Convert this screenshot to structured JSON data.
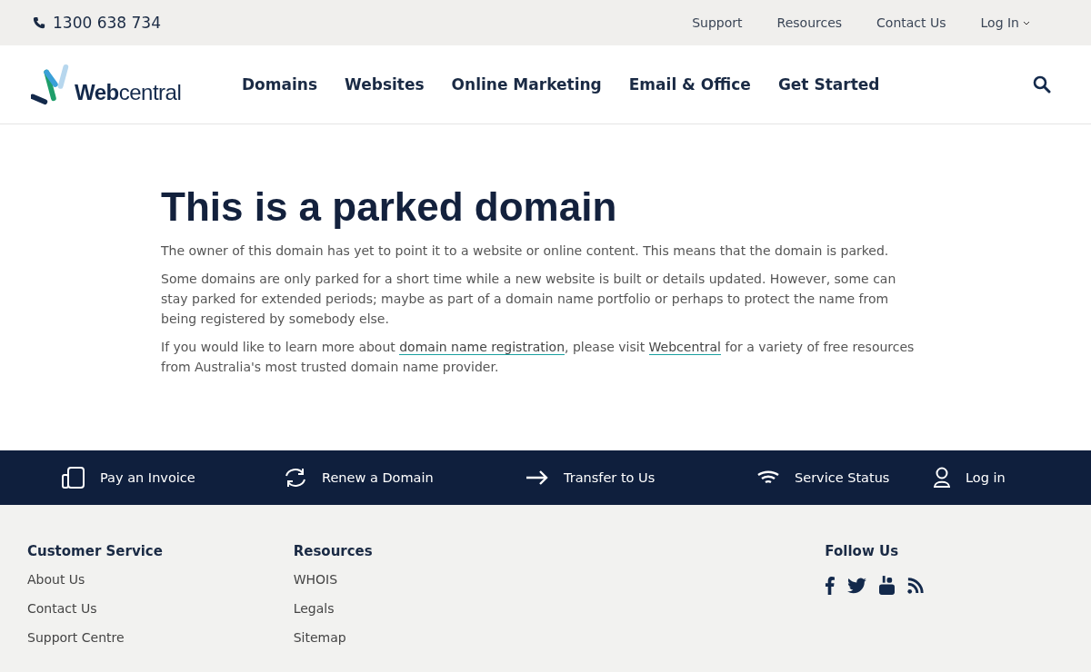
{
  "top_bar": {
    "phone": "1300 638 734",
    "links": [
      {
        "label": "Support",
        "kind": "link"
      },
      {
        "label": "Resources",
        "kind": "link"
      },
      {
        "label": "Contact Us",
        "kind": "link"
      },
      {
        "label": "Log In",
        "kind": "dropdown"
      }
    ]
  },
  "header": {
    "logo": "**Web**central",
    "nav": [
      "Domains",
      "Websites",
      "Online Marketing",
      "Email & Office",
      "Get Started"
    ]
  },
  "main": {
    "title": "This is a parked domain",
    "paragraphs": [
      [
        {
          "kind": "text",
          "text": "The owner of this domain has yet to point it to a website or online content. This means that the domain is parked."
        }
      ],
      [
        {
          "kind": "text",
          "text": "Some domains are only parked for a short time while a new website is built or details updated. However, some can stay parked for extended periods; maybe as part of a domain name portfolio or perhaps to protect the name from being registered by somebody else."
        }
      ],
      [
        {
          "kind": "text",
          "text": "If you would like to learn more about "
        },
        {
          "kind": "link",
          "text": "domain name registration"
        },
        {
          "kind": "text",
          "text": ", please visit "
        },
        {
          "kind": "link",
          "text": "Webcentral"
        },
        {
          "kind": "text",
          "text": " for a variety of free resources from Australia's most trusted domain name provider."
        }
      ]
    ]
  },
  "quick_links": [
    "Pay an Invoice",
    "Renew a Domain",
    "Transfer to Us",
    "Service Status",
    "Log in"
  ],
  "footer": {
    "columns": [
      {
        "heading": "Customer Service",
        "links": [
          "About Us",
          "Contact Us",
          "Support Centre"
        ]
      },
      {
        "heading": "Resources",
        "links": [
          "WHOIS",
          "Legals",
          "Sitemap"
        ]
      }
    ],
    "follow": {
      "heading": "Follow Us"
    }
  }
}
